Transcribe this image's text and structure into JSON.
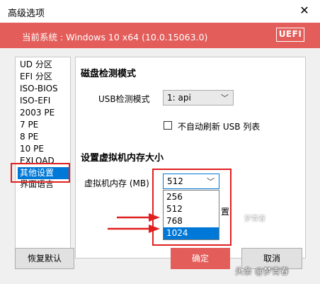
{
  "window": {
    "title": "高级选项",
    "close_glyph": "✕"
  },
  "banner": {
    "system_text": "当前系统 : Windows 10 x64 (10.0.15063.0)",
    "badge": "UEFI"
  },
  "list": {
    "items": [
      "UD 分区",
      "EFI 分区",
      "ISO-BIOS",
      "ISO-EFI",
      "2003 PE",
      "7 PE",
      "8 PE",
      "10 PE",
      "EXLOAD",
      "其他设置",
      "界面语言"
    ],
    "selected": "其他设置"
  },
  "disk_section": {
    "heading": "磁盘检测模式",
    "usb_label": "USB检测模式",
    "usb_value": "1: api",
    "checkbox_label": "不自动刷新 USB 列表",
    "checkbox_checked": false
  },
  "memory_section": {
    "heading": "设置虚拟机内存大小",
    "label": "虚拟机内存 (MB)",
    "value": "512",
    "options": [
      "256",
      "512",
      "768",
      "1024"
    ],
    "highlighted": "1024",
    "partial_hidden_text": "置"
  },
  "buttons": {
    "restore": "恢复默认",
    "ok": "确定",
    "cancel": "取消"
  },
  "watermark": {
    "text": "头条 @梦青春",
    "text2": "梦青春"
  },
  "colors": {
    "accent": "#e35d5a",
    "selection": "#0078d7",
    "annotation": "#e02020"
  }
}
